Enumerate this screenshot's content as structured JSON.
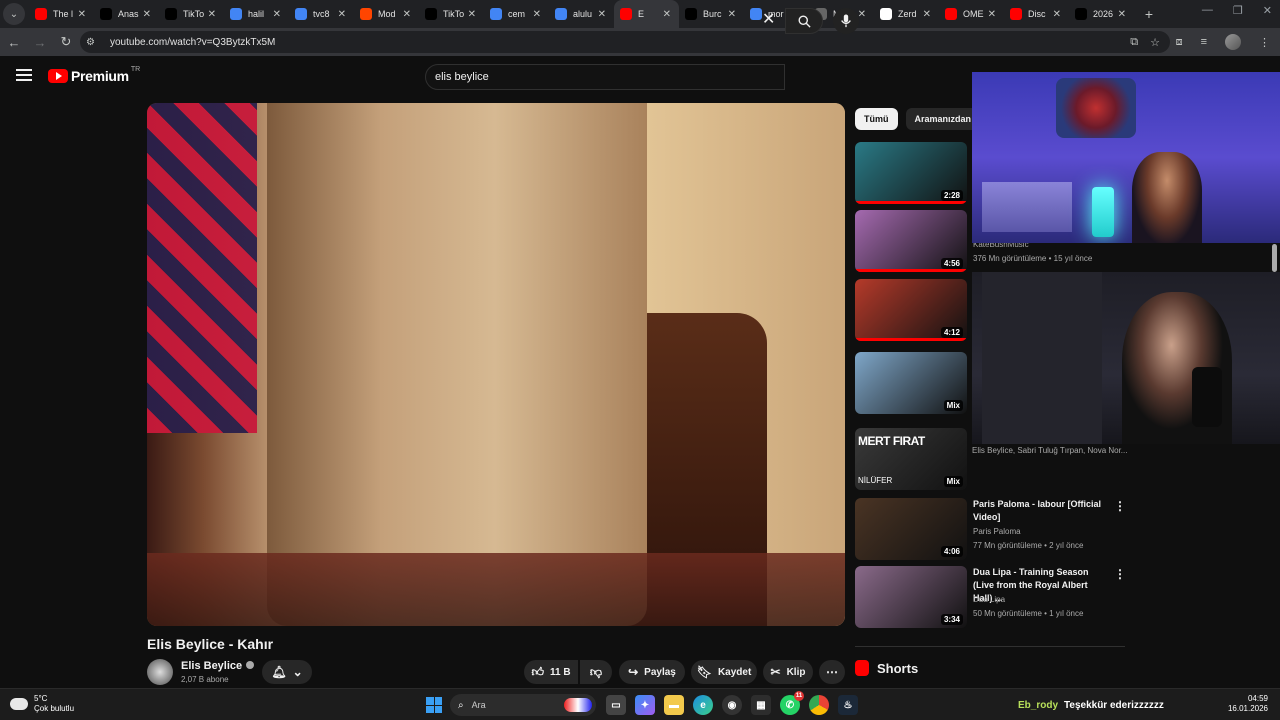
{
  "browser": {
    "tabs": [
      {
        "title": "The l",
        "favicon": "youtube-icon",
        "color": "#ff0000"
      },
      {
        "title": "Anas",
        "favicon": "x-icon",
        "color": "#000000"
      },
      {
        "title": "TikTo",
        "favicon": "tiktok-icon",
        "color": "#000000"
      },
      {
        "title": "halil",
        "favicon": "google-icon",
        "color": "#4285f4"
      },
      {
        "title": "tvc8",
        "favicon": "google-icon",
        "color": "#4285f4"
      },
      {
        "title": "Mod",
        "favicon": "reddit-icon",
        "color": "#ff4500"
      },
      {
        "title": "TikTo",
        "favicon": "tiktok-icon",
        "color": "#000000"
      },
      {
        "title": "cem",
        "favicon": "google-icon",
        "color": "#4285f4"
      },
      {
        "title": "alulu",
        "favicon": "google-icon",
        "color": "#4285f4"
      },
      {
        "title": "E",
        "favicon": "youtube-icon",
        "color": "#ff0000",
        "active": true
      },
      {
        "title": "Burc",
        "favicon": "threads-icon",
        "color": "#000000"
      },
      {
        "title": "mor",
        "favicon": "google-icon",
        "color": "#4285f4"
      },
      {
        "title": "MOR",
        "favicon": "generic-icon",
        "color": "#666666"
      },
      {
        "title": "Zerd",
        "favicon": "wikipedia-icon",
        "color": "#ffffff"
      },
      {
        "title": "OME",
        "favicon": "youtube-icon",
        "color": "#ff0000"
      },
      {
        "title": "Disc",
        "favicon": "youtube-icon",
        "color": "#ff0000"
      },
      {
        "title": "2026",
        "favicon": "threads-icon",
        "color": "#000000"
      }
    ],
    "url": "youtube.com/watch?v=Q3BytzkTx5M"
  },
  "youtube": {
    "logo_word": "Premium",
    "region": "TR",
    "search_value": "elis beylice",
    "video": {
      "title": "Elis Beylice - Kahır",
      "channel": "Elis Beylice",
      "subscribers": "2,07 B abone",
      "likes": "11 B",
      "share_label": "Paylaş",
      "save_label": "Kaydet",
      "clip_label": "Klip"
    },
    "chips": [
      {
        "label": "Tümü",
        "active": true
      },
      {
        "label": "Aramanızdan",
        "active": false
      }
    ],
    "recommendations": [
      {
        "duration": "2:28",
        "progress": 1.0,
        "thumb": "#2a7a86"
      },
      {
        "duration": "4:56",
        "progress": 1.0,
        "thumb": "#a56ab0"
      },
      {
        "duration": "4:12",
        "progress": 1.0,
        "thumb": "#b53a2a"
      },
      {
        "duration": "Mix",
        "progress": 0,
        "thumb": "#7fa7c9"
      },
      {
        "duration": "Mix",
        "progress": 0,
        "thumb": "#3a3a3a",
        "overlay_title": "MERT FIRAT",
        "overlay_sub": "NİLÜFER"
      },
      {
        "duration": "4:06",
        "progress": 0,
        "thumb": "#4a3424"
      },
      {
        "duration": "3:34",
        "progress": 0,
        "thumb": "#8a6a8a"
      }
    ],
    "rec_texts": {
      "r2_channel": "KateBushMusic",
      "r2_meta": "376 Mn görüntüleme • 15 yıl önce",
      "r5_meta": "Elis Beylice, Sabri Tuluğ Tırpan, Nova Nor...",
      "r6_title": "Paris Paloma - labour [Official Video]",
      "r6_channel": "Paris Paloma",
      "r6_meta": "77 Mn görüntüleme • 2 yıl önce",
      "r7_title": "Dua Lipa - Training Season (Live from the Royal Albert Hall) ...",
      "r7_channel": "Dua Lipa",
      "r7_meta": "50 Mn görüntüleme • 1 yıl önce"
    },
    "shorts_label": "Shorts"
  },
  "taskbar": {
    "temperature": "5°C",
    "weather": "Çok bulutlu",
    "search_placeholder": "Ara",
    "badge_count": "11",
    "chat_user": "Eb_rody",
    "chat_text": "Teşekkür ederizzzzzz",
    "time": "04:59",
    "date": "16.01.2026"
  }
}
